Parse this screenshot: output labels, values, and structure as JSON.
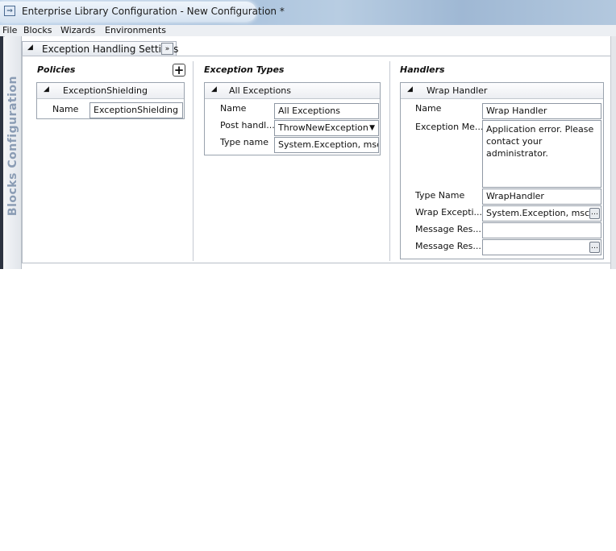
{
  "window": {
    "title": "Enterprise Library Configuration - New Configuration *",
    "icon": "app-icon"
  },
  "menu": {
    "file": "File",
    "blocks": "Blocks",
    "wizards": "Wizards",
    "environments": "Environments"
  },
  "sidetab": {
    "label": "Blocks Configuration"
  },
  "section": {
    "title": "Exception Handling Settings",
    "collapse_icon": "double-chevron-icon"
  },
  "policies": {
    "title": "Policies",
    "add_icon": "plus-icon",
    "card": {
      "title": "ExceptionShielding",
      "name_label": "Name",
      "name_value": "ExceptionShielding"
    }
  },
  "exception_types": {
    "title": "Exception Types",
    "card": {
      "title": "All Exceptions",
      "name_label": "Name",
      "name_value": "All Exceptions",
      "post_label": "Post handl...",
      "post_value": "ThrowNewException",
      "type_label": "Type name",
      "type_value": "System.Exception, mscor"
    }
  },
  "handlers": {
    "title": "Handlers",
    "card": {
      "title": "Wrap Handler",
      "name_label": "Name",
      "name_value": "Wrap Handler",
      "msg_label": "Exception Me...",
      "msg_value": "Application error. Please contact your administrator.",
      "typename_label": "Type Name",
      "typename_value": "WrapHandler",
      "wrap_label": "Wrap Excepti...",
      "wrap_value": "System.Exception, mscor",
      "res1_label": "Message Res...",
      "res1_value": "",
      "res2_label": "Message Res...",
      "res2_value": ""
    }
  }
}
